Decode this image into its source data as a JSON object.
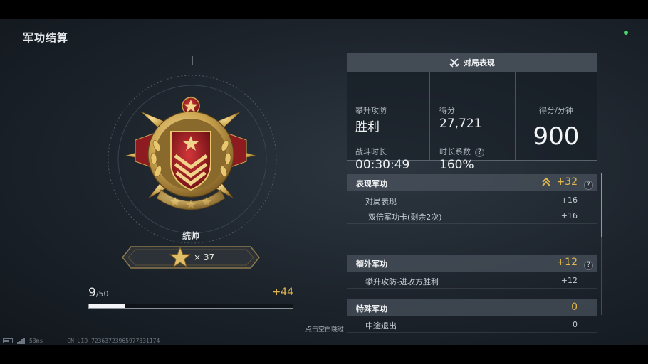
{
  "header": {
    "title": "军功结算"
  },
  "medal": {
    "rank_name": "统帅",
    "star_count": "× 37",
    "colors": {
      "gold": "#c9a24e",
      "red": "#a51d22"
    }
  },
  "progress": {
    "current": "9",
    "max": "/50",
    "fraction": 0.18,
    "gain": "+44"
  },
  "performance": {
    "header_label": "对局表现",
    "mode_label": "攀升攻防",
    "mode_value": "胜利",
    "score_label": "得分",
    "score_value": "27,721",
    "spm_label": "得分/分钟",
    "spm_value": "900",
    "duration_label": "战斗时长",
    "duration_value": "00:30:49",
    "multiplier_label": "时长系数",
    "multiplier_value": "160%",
    "help": "?"
  },
  "merits": {
    "performance": {
      "title": "表现军功",
      "value": "+32",
      "help": "?",
      "rows": [
        {
          "label": "对局表现",
          "value": "+16"
        },
        {
          "label": "双倍军功卡(剩余2次)",
          "value": "+16"
        }
      ]
    },
    "extra": {
      "title": "额外军功",
      "value": "+12",
      "help": "?",
      "rows": [
        {
          "label": "攀升攻防-进攻方胜利",
          "value": "+12"
        }
      ]
    },
    "special": {
      "title": "特殊军功",
      "value": "0",
      "rows": [
        {
          "label": "中途退出",
          "value": "0"
        }
      ]
    }
  },
  "footer": {
    "skip_hint": "点击空白跳过",
    "ping": "53ms",
    "uid": "CN UID 72363723965977331174"
  },
  "colors": {
    "accent_gold": "#e3b84a",
    "status_green": "#4ad66d"
  }
}
